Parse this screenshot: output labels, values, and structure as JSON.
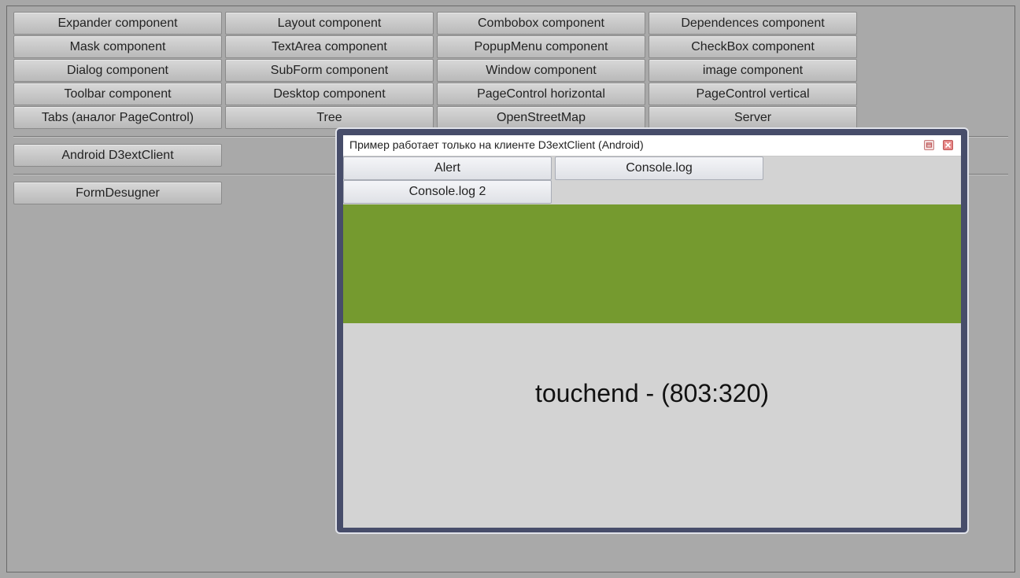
{
  "components": {
    "row1": [
      "Expander component",
      "Layout component",
      "Combobox component",
      "Dependences component"
    ],
    "row2": [
      "Mask component",
      "TextArea component",
      "PopupMenu component",
      "CheckBox component"
    ],
    "row3": [
      "Dialog component",
      "SubForm component",
      "Window component",
      "image component"
    ],
    "row4": [
      "Toolbar component",
      "Desktop component",
      "PageControl horizontal",
      "PageControl vertical"
    ],
    "row5": [
      "Tabs (аналог PageControl)",
      "Tree",
      "OpenStreetMap",
      "Server"
    ]
  },
  "android_button": "Android D3extClient",
  "formdesigner_button": "FormDesugner",
  "window": {
    "title": "Пример работает только на клиенте D3extClient (Android)",
    "buttons": {
      "alert": "Alert",
      "console_log": "Console.log",
      "console_log_2": "Console.log 2"
    },
    "panel_color": "#759a2f",
    "touch_status": "touchend - (803:320)"
  }
}
